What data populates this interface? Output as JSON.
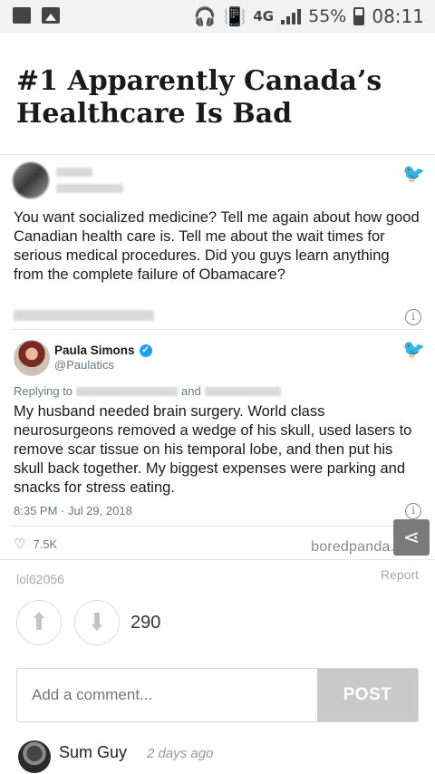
{
  "status_bar": {
    "network": "4G",
    "battery": "55%",
    "time": "08:11"
  },
  "post": {
    "title": "#1 Apparently Canada’s Healthcare Is Bad",
    "author": "lol62056",
    "report_label": "Report",
    "score": "290"
  },
  "tweet1": {
    "text": "You want socialized medicine? Tell me again about how good Canadian health care is. Tell me about the wait times for serious medical procedures. Did you guys learn anything from the complete failure of Obamacare?"
  },
  "tweet2": {
    "name": "Paula Simons",
    "handle": "@Paulatics",
    "replying_to": "Replying to",
    "and_word": "and",
    "text": "My husband needed brain surgery. World class neurosurgeons removed a wedge of his skull, used lasers to remove scar tissue on his temporal lobe, and then put his skull back together. My biggest expenses were parking and snacks for stress eating.",
    "timestamp": "8:35 PM · Jul 29, 2018",
    "likes": "7.5K"
  },
  "watermark": "boredpanda.com",
  "comment_form": {
    "placeholder": "Add a comment...",
    "post_label": "POST"
  },
  "comment": {
    "user": "Sum Guy",
    "time": "2 days ago"
  },
  "colors": {
    "twitter_blue": "#1da1f2",
    "post_button": "#c9c9c9"
  }
}
